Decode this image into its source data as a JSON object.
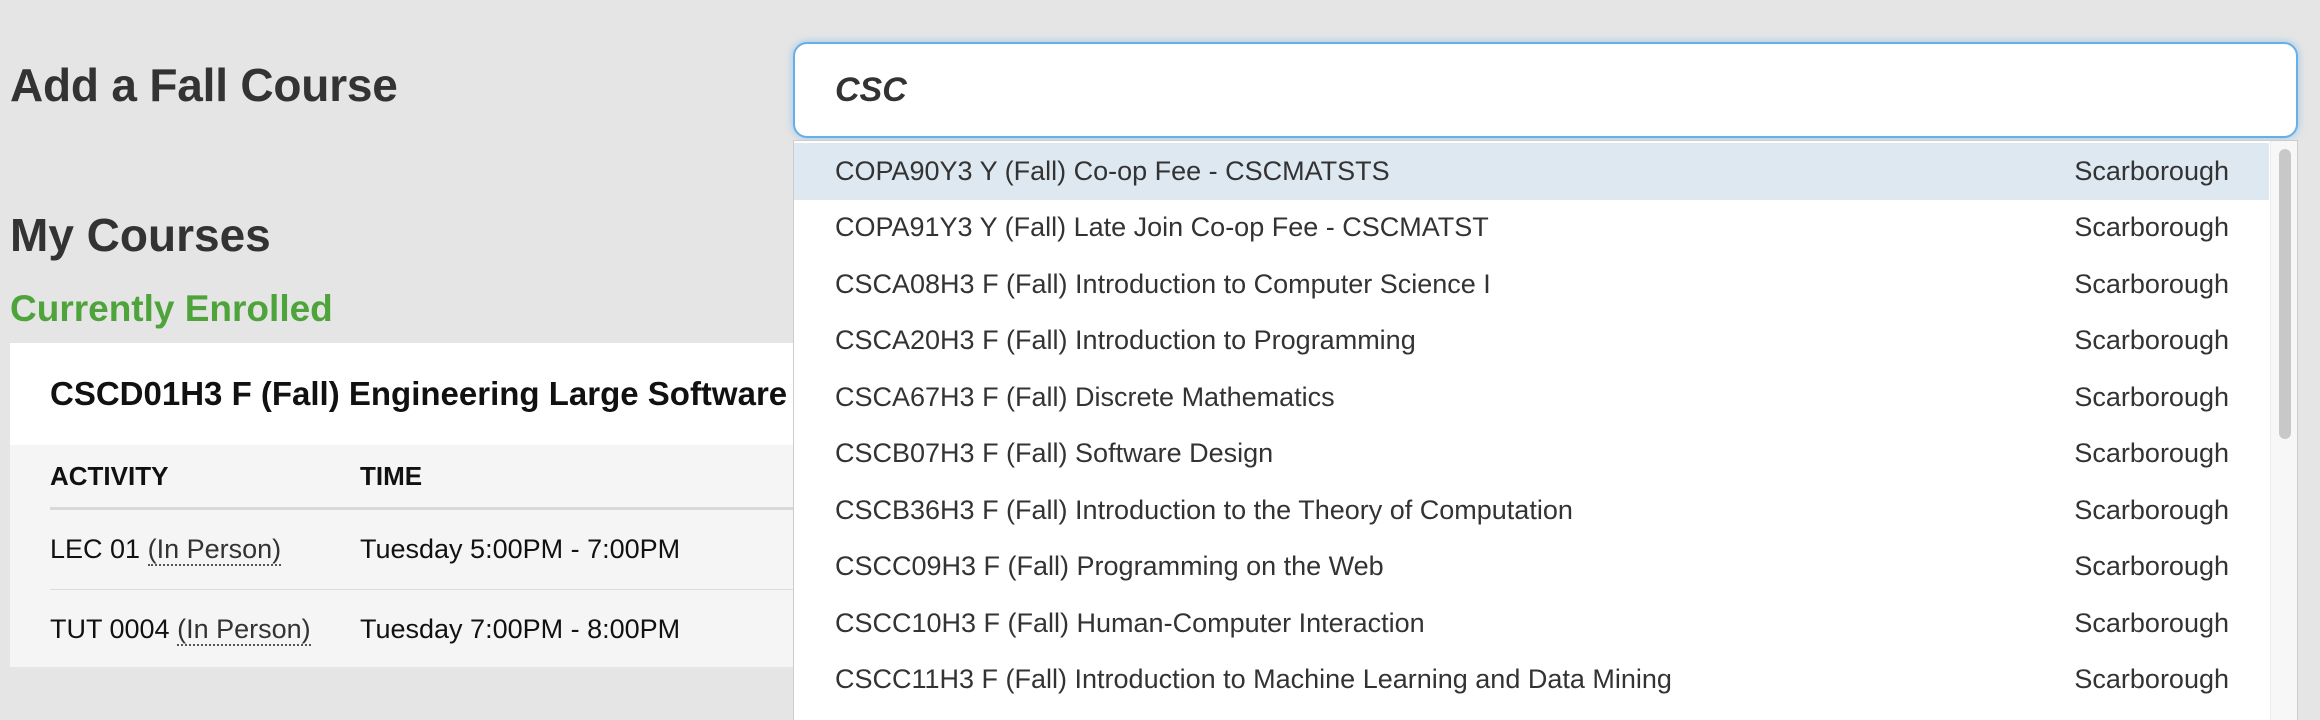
{
  "page": {
    "add_heading": "Add a Fall Course",
    "my_courses_heading": "My Courses",
    "enrolled_label": "Currently Enrolled"
  },
  "search": {
    "value": "CSC"
  },
  "dropdown": {
    "items": [
      {
        "label": "COPA90Y3 Y (Fall) Co-op Fee - CSCMATSTS",
        "campus": "Scarborough",
        "highlighted": true
      },
      {
        "label": "COPA91Y3 Y (Fall) Late Join Co-op Fee - CSCMATST",
        "campus": "Scarborough"
      },
      {
        "label": "CSCA08H3 F (Fall) Introduction to Computer Science I",
        "campus": "Scarborough"
      },
      {
        "label": "CSCA20H3 F (Fall) Introduction to Programming",
        "campus": "Scarborough"
      },
      {
        "label": "CSCA67H3 F (Fall) Discrete Mathematics",
        "campus": "Scarborough"
      },
      {
        "label": "CSCB07H3 F (Fall) Software Design",
        "campus": "Scarborough"
      },
      {
        "label": "CSCB36H3 F (Fall) Introduction to the Theory of Computation",
        "campus": "Scarborough"
      },
      {
        "label": "CSCC09H3 F (Fall) Programming on the Web",
        "campus": "Scarborough"
      },
      {
        "label": "CSCC10H3 F (Fall) Human-Computer Interaction",
        "campus": "Scarborough"
      },
      {
        "label": "CSCC11H3 F (Fall) Introduction to Machine Learning and Data Mining",
        "campus": "Scarborough"
      }
    ]
  },
  "course": {
    "title": "CSCD01H3 F (Fall) Engineering Large Software",
    "columns": {
      "activity": "ACTIVITY",
      "time": "TIME"
    },
    "rows": [
      {
        "activity": "LEC 01",
        "delivery": "(In Person)",
        "time": "Tuesday 5:00PM - 7:00PM"
      },
      {
        "activity": "TUT 0004",
        "delivery": "(In Person)",
        "time": "Tuesday 7:00PM - 8:00PM"
      }
    ]
  },
  "colors": {
    "enrolled_green": "#4ea43a",
    "focus_border": "#66afe9",
    "highlight_row": "#dde8f1",
    "page_background": "#e5e5e5"
  }
}
